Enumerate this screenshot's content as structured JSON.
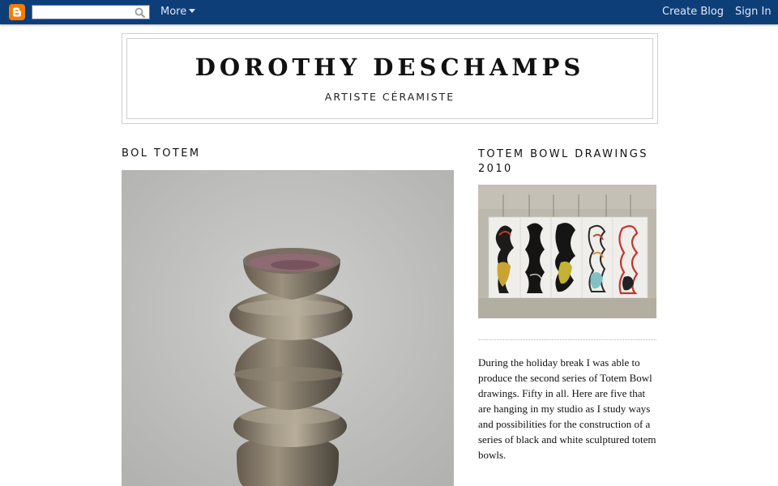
{
  "navbar": {
    "logo_icon": "blogger-logo-icon",
    "search_placeholder": "",
    "more_label": "More",
    "create_blog_label": "Create Blog",
    "sign_in_label": "Sign In",
    "bar_color": "#0d3e78"
  },
  "header": {
    "title": "DOROTHY DESCHAMPS",
    "description": "ARTISTE CÉRAMISTE"
  },
  "post": {
    "title": "BOL TOTEM"
  },
  "sidebar": {
    "title": "TOTEM BOWL DRAWINGS 2010",
    "text": "During the holiday break I was able to produce the second series of Totem Bowl drawings. Fifty in all. Here are five that are hanging in my studio as I study ways and possibilities for the construction of a series of black and white sculptured totem bowls."
  }
}
